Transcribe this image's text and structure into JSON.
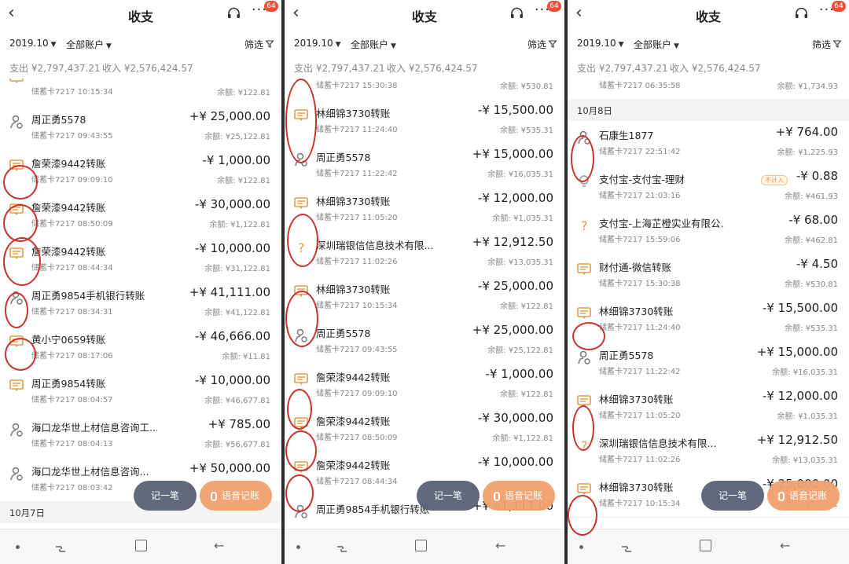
{
  "header": {
    "back": "‹",
    "title": "收支",
    "more": "···",
    "badge": "64"
  },
  "filters": {
    "month": "2019.10",
    "account": "全部账户",
    "screen": "筛选"
  },
  "summary": {
    "expense": "支出 ¥2,797,437.21",
    "income": "收入 ¥2,576,424.57"
  },
  "buttons": {
    "record": "记一笔",
    "voice": "语音记账"
  },
  "colors": {
    "accent": "#e59b3d",
    "annotation": "#c9322a",
    "fab_primary": "#5b6275",
    "fab_voice": "#f2a06e"
  },
  "screens": [
    {
      "items": [
        {
          "kind": "tx",
          "icon": "transfer",
          "name": "",
          "sub": "储蓄卡7217 10:15:34",
          "amount": "",
          "balance": "余额: ¥122.81"
        },
        {
          "kind": "tx",
          "icon": "person",
          "name": "周正勇5578",
          "sub": "储蓄卡7217 09:43:55",
          "amount": "+¥ 25,000.00",
          "balance": "余额: ¥25,122.81"
        },
        {
          "kind": "tx",
          "icon": "transfer",
          "name": "詹荣漆9442转账",
          "sub": "储蓄卡7217 09:09:10",
          "amount": "-¥ 1,000.00",
          "balance": "余额: ¥122.81"
        },
        {
          "kind": "tx",
          "icon": "transfer",
          "name": "詹荣漆9442转账",
          "sub": "储蓄卡7217 08:50:09",
          "amount": "-¥ 30,000.00",
          "balance": "余额: ¥1,122.81"
        },
        {
          "kind": "tx",
          "icon": "transfer",
          "name": "詹荣漆9442转账",
          "sub": "储蓄卡7217 08:44:34",
          "amount": "-¥ 10,000.00",
          "balance": "余额: ¥31,122.81"
        },
        {
          "kind": "tx",
          "icon": "person",
          "name": "周正勇9854手机银行转账",
          "sub": "储蓄卡7217 08:34:31",
          "amount": "+¥ 41,111.00",
          "balance": "余额: ¥41,122.81"
        },
        {
          "kind": "tx",
          "icon": "transfer",
          "name": "黄小宁0659转账",
          "sub": "储蓄卡7217 08:17:06",
          "amount": "-¥ 46,666.00",
          "balance": "余额: ¥11.81"
        },
        {
          "kind": "tx",
          "icon": "transfer",
          "name": "周正勇9854转账",
          "sub": "储蓄卡7217 08:04:57",
          "amount": "-¥ 10,000.00",
          "balance": "余额: ¥46,677.81"
        },
        {
          "kind": "tx",
          "icon": "person",
          "name": "海口龙华世上材信息咨询工...",
          "sub": "储蓄卡7217 08:04:13",
          "amount": "+¥ 785.00",
          "balance": "余额: ¥56,677.81"
        },
        {
          "kind": "tx",
          "icon": "person",
          "name": "海口龙华世上材信息咨询...",
          "sub": "储蓄卡7217 08:03:42",
          "amount": "+¥ 50,000.00",
          "balance": ""
        },
        {
          "kind": "group",
          "label": "10月7日"
        }
      ]
    },
    {
      "items": [
        {
          "kind": "tx",
          "icon": "transfer",
          "name": "财付通-微信转账",
          "sub": "储蓄卡7217 15:30:38",
          "amount": "-¥ 4.50",
          "balance": "余额: ¥530.81"
        },
        {
          "kind": "tx",
          "icon": "transfer",
          "name": "林细锦3730转账",
          "sub": "储蓄卡7217 11:24:40",
          "amount": "-¥ 15,500.00",
          "balance": "余额: ¥535.31"
        },
        {
          "kind": "tx",
          "icon": "person",
          "name": "周正勇5578",
          "sub": "储蓄卡7217 11:22:42",
          "amount": "+¥ 15,000.00",
          "balance": "余额: ¥16,035.31"
        },
        {
          "kind": "tx",
          "icon": "transfer",
          "name": "林细锦3730转账",
          "sub": "储蓄卡7217 11:05:20",
          "amount": "-¥ 12,000.00",
          "balance": "余额: ¥1,035.31"
        },
        {
          "kind": "tx",
          "icon": "question",
          "name": "深圳瑞银信信息技术有限...",
          "sub": "储蓄卡7217 11:02:26",
          "amount": "+¥ 12,912.50",
          "balance": "余额: ¥13,035.31"
        },
        {
          "kind": "tx",
          "icon": "transfer",
          "name": "林细锦3730转账",
          "sub": "储蓄卡7217 10:15:34",
          "amount": "-¥ 25,000.00",
          "balance": "余额: ¥122.81"
        },
        {
          "kind": "tx",
          "icon": "person",
          "name": "周正勇5578",
          "sub": "储蓄卡7217 09:43:55",
          "amount": "+¥ 25,000.00",
          "balance": "余额: ¥25,122.81"
        },
        {
          "kind": "tx",
          "icon": "transfer",
          "name": "詹荣漆9442转账",
          "sub": "储蓄卡7217 09:09:10",
          "amount": "-¥ 1,000.00",
          "balance": "余额: ¥122.81"
        },
        {
          "kind": "tx",
          "icon": "transfer",
          "name": "詹荣漆9442转账",
          "sub": "储蓄卡7217 08:50:09",
          "amount": "-¥ 30,000.00",
          "balance": "余额: ¥1,122.81"
        },
        {
          "kind": "tx",
          "icon": "transfer",
          "name": "詹荣漆9442转账",
          "sub": "储蓄卡7217 08:44:34",
          "amount": "-¥ 10,000.00",
          "balance": ""
        },
        {
          "kind": "tx",
          "icon": "person",
          "name": "周正勇9854手机银行转账",
          "sub": "",
          "amount": "+¥ 41,111.00",
          "balance": ""
        }
      ]
    },
    {
      "items": [
        {
          "kind": "tx",
          "icon": "clock",
          "name": "",
          "sub": "储蓄卡7217 06:35:58",
          "amount": "",
          "balance": "余额: ¥1,734.93"
        },
        {
          "kind": "group",
          "label": "10月8日"
        },
        {
          "kind": "tx",
          "icon": "person",
          "name": "石康生1877",
          "sub": "储蓄卡7217 22:51:42",
          "amount": "+¥ 764.00",
          "balance": "余额: ¥1,225.93"
        },
        {
          "kind": "tx",
          "icon": "bulb",
          "name": "支付宝-支付宝-理财",
          "sub": "储蓄卡7217 21:03:16",
          "amount": "-¥ 0.88",
          "balance": "余额: ¥461.93",
          "tag": "不计入"
        },
        {
          "kind": "tx",
          "icon": "question",
          "name": "支付宝-上海芷橙实业有限公...",
          "sub": "储蓄卡7217 15:59:06",
          "amount": "-¥ 68.00",
          "balance": "余额: ¥462.81"
        },
        {
          "kind": "tx",
          "icon": "transfer",
          "name": "财付通-微信转账",
          "sub": "储蓄卡7217 15:30:38",
          "amount": "-¥ 4.50",
          "balance": "余额: ¥530.81"
        },
        {
          "kind": "tx",
          "icon": "transfer",
          "name": "林细锦3730转账",
          "sub": "储蓄卡7217 11:24:40",
          "amount": "-¥ 15,500.00",
          "balance": "余额: ¥535.31"
        },
        {
          "kind": "tx",
          "icon": "person",
          "name": "周正勇5578",
          "sub": "储蓄卡7217 11:22:42",
          "amount": "+¥ 15,000.00",
          "balance": "余额: ¥16,035.31"
        },
        {
          "kind": "tx",
          "icon": "transfer",
          "name": "林细锦3730转账",
          "sub": "储蓄卡7217 11:05:20",
          "amount": "-¥ 12,000.00",
          "balance": "余额: ¥1,035.31"
        },
        {
          "kind": "tx",
          "icon": "question",
          "name": "深圳瑞银信信息技术有限...",
          "sub": "储蓄卡7217 11:02:26",
          "amount": "+¥ 12,912.50",
          "balance": "余额: ¥13,035.31"
        },
        {
          "kind": "tx",
          "icon": "transfer",
          "name": "林细锦3730转账",
          "sub": "储蓄卡7217 10:15:34",
          "amount": "-¥ 25,000.00",
          "balance": "余额: ¥122.81"
        }
      ]
    }
  ]
}
